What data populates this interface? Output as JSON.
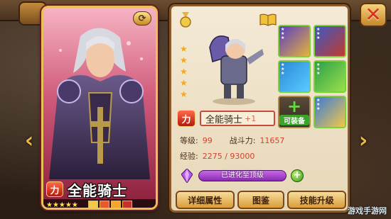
{
  "hero_card": {
    "badge": "力",
    "name": "全能骑士",
    "stars": "★★★★★"
  },
  "detail": {
    "badge": "力",
    "name": "全能骑士",
    "plus": "+1",
    "level_label": "等级:",
    "level_value": "99",
    "power_label": "战斗力:",
    "power_value": "11657",
    "exp_label": "经验:",
    "exp_value": "2275 / 93000",
    "evolve_text": "已进化至顶级",
    "can_equip": "可装备"
  },
  "buttons": {
    "details": "详细属性",
    "guide": "图鉴",
    "skill_upgrade": "技能升级"
  },
  "nav": {
    "left_arrow": "‹",
    "right_arrow": "›",
    "close": "✕"
  },
  "watermark": "游戏手游网",
  "colors": {
    "card_frame": "#e8c15a",
    "accent_red": "#d8402a",
    "evolve_purple": "#8a2ab4",
    "equip_green": "#7ad13a"
  }
}
